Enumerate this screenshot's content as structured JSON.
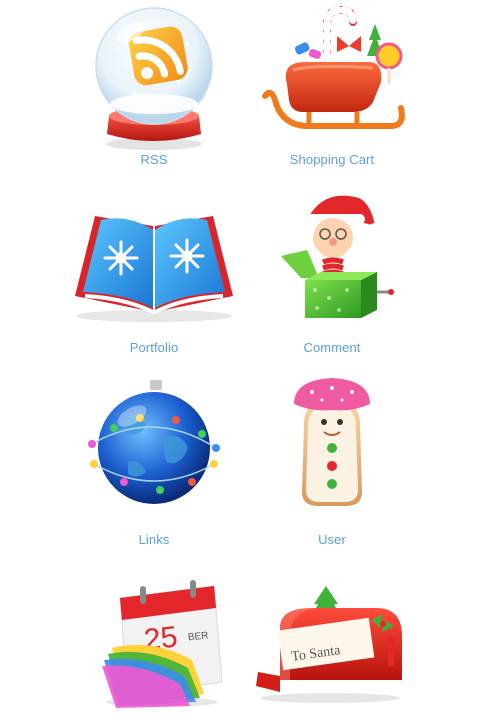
{
  "grid": {
    "items": [
      {
        "label": "RSS",
        "icon": "rss-snow-globe-icon"
      },
      {
        "label": "Shopping Cart",
        "icon": "sleigh-cart-icon"
      },
      {
        "label": "Portfolio",
        "icon": "snowflake-book-icon"
      },
      {
        "label": "Comment",
        "icon": "santa-jack-in-box-icon"
      },
      {
        "label": "Links",
        "icon": "globe-ornament-icon"
      },
      {
        "label": "User",
        "icon": "gingerbread-man-icon"
      },
      {
        "label": "",
        "icon": "calendar-icon"
      },
      {
        "label": "",
        "icon": "mailbox-icon"
      }
    ]
  },
  "calendar": {
    "day": "25",
    "month": "BER"
  },
  "mailbox": {
    "letter": "To Santa"
  },
  "colors": {
    "label": "#5b9fd3",
    "red": "#e8332a",
    "blue": "#1e6fd0",
    "green": "#3aa53a"
  }
}
